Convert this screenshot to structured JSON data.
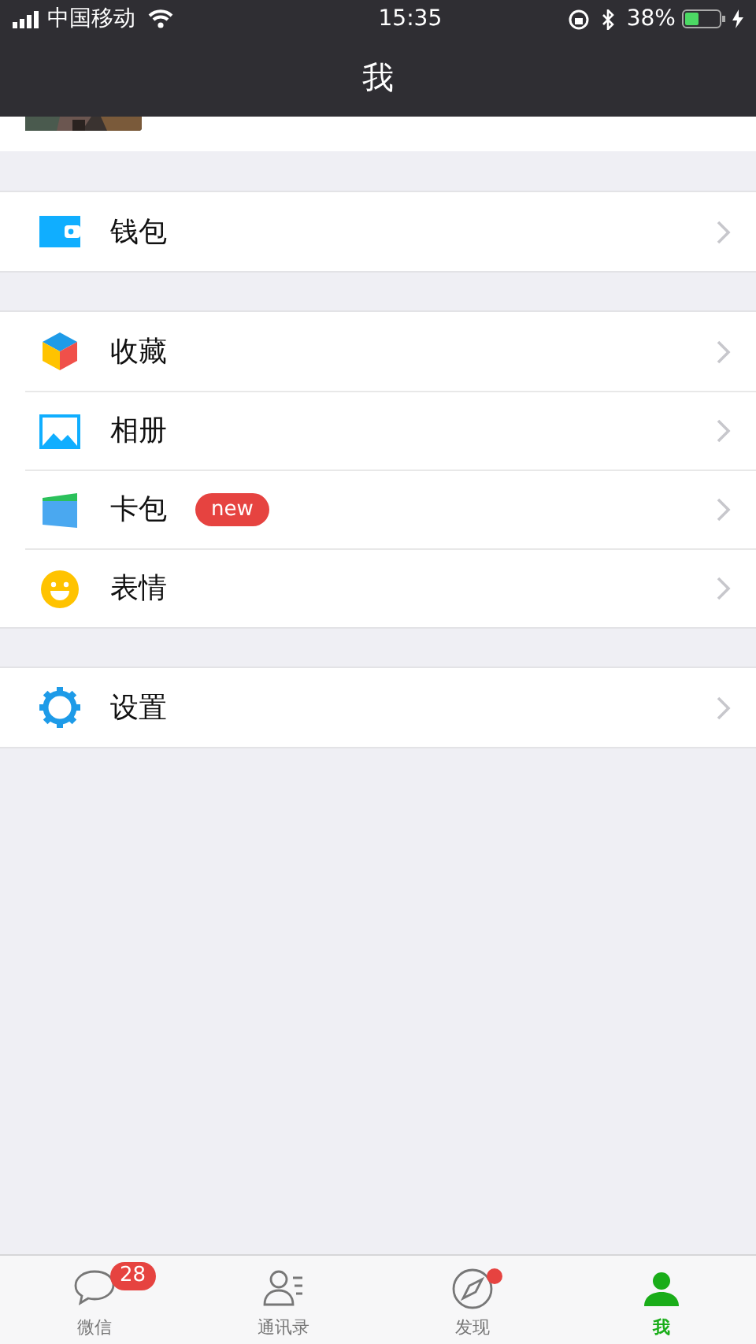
{
  "status_bar": {
    "carrier": "中国移动",
    "time": "15:35",
    "battery": "38%"
  },
  "nav_bar": {
    "title": "我"
  },
  "menu_groups": [
    {
      "items": [
        {
          "label": "钱包"
        }
      ]
    },
    {
      "items": [
        {
          "label": "收藏"
        },
        {
          "label": "相册"
        },
        {
          "label": "卡包",
          "badge": "new"
        },
        {
          "label": "表情"
        }
      ]
    },
    {
      "items": [
        {
          "label": "设置"
        }
      ]
    }
  ],
  "tab_bar": [
    {
      "label": "微信",
      "selected": false,
      "badge": "28",
      "dot": false
    },
    {
      "label": "通讯录",
      "selected": false,
      "dot": false
    },
    {
      "label": "发现",
      "selected": false,
      "dot": true
    },
    {
      "label": "我",
      "selected": true,
      "dot": false
    }
  ]
}
